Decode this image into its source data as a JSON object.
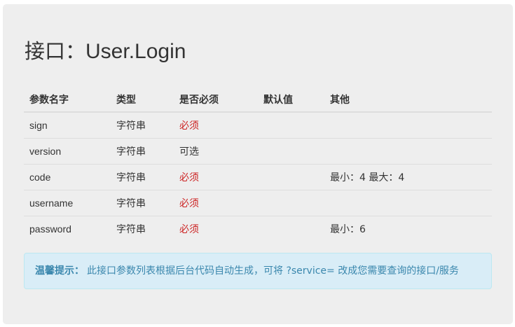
{
  "page": {
    "title_prefix": "接口：",
    "title_name": "User.Login"
  },
  "table": {
    "headers": [
      "参数名字",
      "类型",
      "是否必须",
      "默认值",
      "其他"
    ],
    "rows": [
      {
        "name": "sign",
        "type": "字符串",
        "required": "必须",
        "default": "",
        "other": ""
      },
      {
        "name": "version",
        "type": "字符串",
        "required": "可选",
        "default": "",
        "other": ""
      },
      {
        "name": "code",
        "type": "字符串",
        "required": "必须",
        "default": "",
        "other": "最小：4 最大：4"
      },
      {
        "name": "username",
        "type": "字符串",
        "required": "必须",
        "default": "",
        "other": ""
      },
      {
        "name": "password",
        "type": "字符串",
        "required": "必须",
        "default": "",
        "other": "最小：6"
      }
    ]
  },
  "tip": {
    "label": "温馨提示：",
    "text": "此接口参数列表根据后台代码自动生成，可将 ?service= 改成您需要查询的接口/服务"
  },
  "colors": {
    "required": "#cc2222",
    "tip_text": "#3a87ad",
    "tip_background": "#d9edf7"
  }
}
